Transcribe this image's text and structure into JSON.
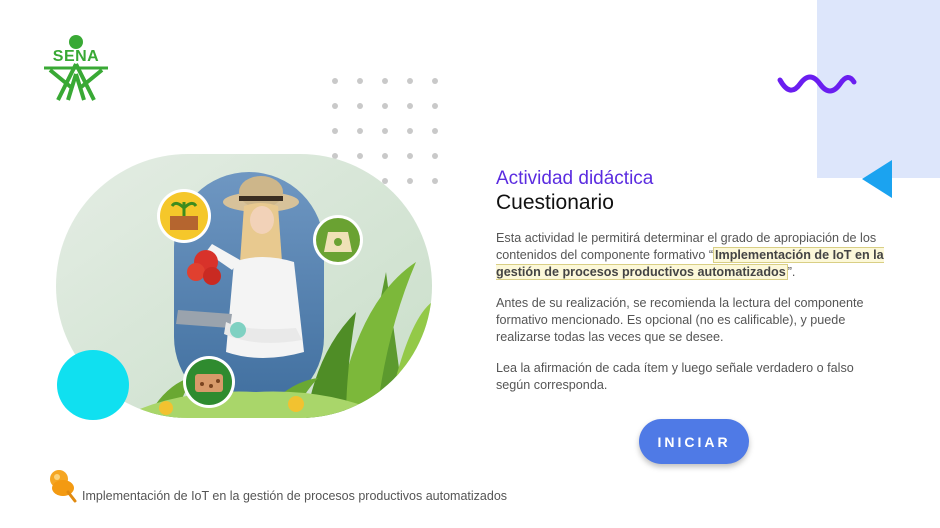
{
  "logo": {
    "text": "SENA",
    "color": "#39a935"
  },
  "activity": {
    "subtitle": "Actividad didáctica",
    "title": "Cuestionario",
    "para1_before": "Esta actividad le permitirá determinar el grado de apropiación de los contenidos del componente formativo “",
    "para1_highlight": "Implementación de IoT en la gestión de procesos productivos automatizados",
    "para1_after": "”.",
    "para2": "Antes de su realización, se recomienda la lectura del componente formativo mencionado. Es opcional (no es calificable), y puede realizarse todas las veces que se desee.",
    "para3": "Lea la afirmación de cada ítem y luego señale verdadero o falso según corresponda."
  },
  "start_button": {
    "label": "INICIAR",
    "color": "#4f7ae6"
  },
  "footer": {
    "text": "Implementación de IoT en la gestión de procesos productivos automatizados",
    "icon": "pushpin-icon"
  },
  "colors": {
    "accent_purple": "#5b2ce0",
    "cyan": "#10e0f0",
    "panel_blue": "#dde6fb",
    "triangle_blue": "#1ba3f0"
  },
  "icons": [
    "seedling-box-icon",
    "plant-bag-icon",
    "soil-icon",
    "squiggle-decoration",
    "triangle-decoration"
  ]
}
